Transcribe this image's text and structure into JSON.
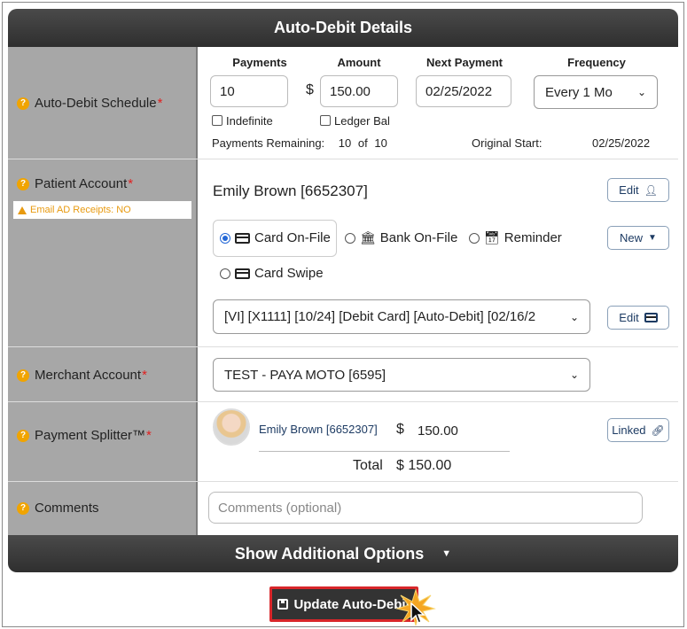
{
  "header": {
    "title": "Auto-Debit Details"
  },
  "schedule": {
    "label": "Auto-Debit Schedule",
    "required_mark": "*",
    "payments_head": "Payments",
    "amount_head": "Amount",
    "next_payment_head": "Next Payment",
    "frequency_head": "Frequency",
    "payments_value": "10",
    "currency": "$",
    "amount_value": "150.00",
    "next_payment_value": "02/25/2022",
    "frequency_value": "Every 1 Mo",
    "indefinite_label": "Indefinite",
    "ledger_bal_label": "Ledger Bal",
    "remaining_label": "Payments Remaining:",
    "remaining_count": "10",
    "remaining_of": "of",
    "remaining_total": "10",
    "original_start_label": "Original Start:",
    "original_start_value": "02/25/2022"
  },
  "patient": {
    "label": "Patient Account",
    "required_mark": "*",
    "warning": "Email AD Receipts: NO",
    "name": "Emily Brown [6652307]",
    "edit_label": "Edit",
    "new_label": "New",
    "options": [
      "Card On-File",
      "Bank On-File",
      "Reminder",
      "Card Swipe"
    ],
    "selected_option": "Card On-File",
    "card_value": "[VI] [X1111] [10/24] [Debit Card] [Auto-Debit] [02/16/2",
    "card_edit_label": "Edit"
  },
  "merchant": {
    "label": "Merchant Account",
    "required_mark": "*",
    "value": "TEST - PAYA MOTO [6595]"
  },
  "splitter": {
    "label": "Payment Splitter™",
    "required_mark": "*",
    "person": "Emily Brown [6652307]",
    "currency": "$",
    "amount": "150.00",
    "linked_label": "Linked",
    "total_label": "Total",
    "total_value": "$ 150.00"
  },
  "comments": {
    "label": "Comments",
    "placeholder": "Comments (optional)"
  },
  "footer": {
    "show_options_label": "Show Additional Options"
  },
  "actions": {
    "update_label": "Update Auto-Debit"
  },
  "colors": {
    "bar_dark": "#333333",
    "label_bg": "#a7a7a7",
    "question_icon": "#f0a400",
    "required": "#e02020",
    "warning": "#e89a10",
    "link": "#1d3b63",
    "update_border": "#d8262a"
  }
}
